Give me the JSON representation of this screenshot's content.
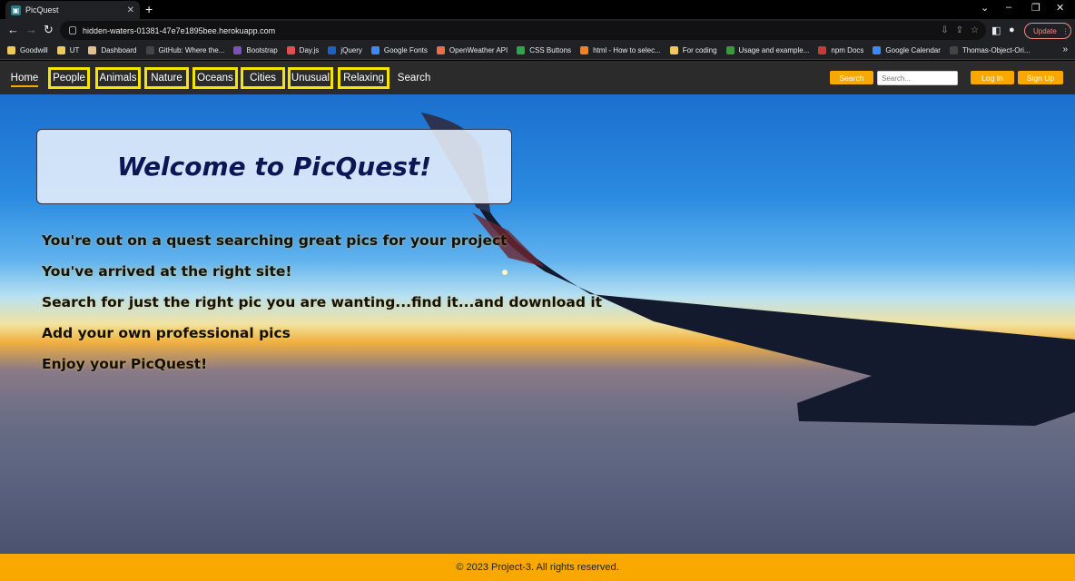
{
  "browser": {
    "tab_title": "PicQuest",
    "url": "hidden-waters-01381-47e7e1895bee.herokuapp.com",
    "update_label": "Update",
    "bookmarks": [
      {
        "label": "Goodwill",
        "color": "#f3c85a"
      },
      {
        "label": "UT",
        "color": "#f3c85a"
      },
      {
        "label": "Dashboard",
        "color": "#e0c090"
      },
      {
        "label": "GitHub: Where the...",
        "color": "#444444"
      },
      {
        "label": "Bootstrap",
        "color": "#7952b3"
      },
      {
        "label": "Day.js",
        "color": "#e05050"
      },
      {
        "label": "jQuery",
        "color": "#2060c0"
      },
      {
        "label": "Google Fonts",
        "color": "#4285f4"
      },
      {
        "label": "OpenWeather API",
        "color": "#e96e50"
      },
      {
        "label": "CSS Buttons",
        "color": "#2ea44f"
      },
      {
        "label": "html - How to selec...",
        "color": "#f48024"
      },
      {
        "label": "For coding",
        "color": "#f3c85a"
      },
      {
        "label": "Usage and example...",
        "color": "#3a9a3a"
      },
      {
        "label": "npm Docs",
        "color": "#cb3837"
      },
      {
        "label": "Google Calendar",
        "color": "#4285f4"
      },
      {
        "label": "Thomas-Object-Ori...",
        "color": "#444444"
      }
    ]
  },
  "nav": {
    "home": "Home",
    "people": "People",
    "animals": "Animals",
    "nature": "Nature",
    "oceans": "Oceans",
    "cities": "Cities",
    "unusual": "Unusual",
    "relaxing": "Relaxing",
    "search": "Search",
    "search_button": "Search",
    "search_placeholder": "Search...",
    "login": "Log In",
    "signup": "Sign Up"
  },
  "hero": {
    "title": "Welcome to PicQuest!",
    "lines": [
      "You're out on a quest searching great pics for your project",
      "You've arrived at the right site!",
      "Search for just the right pic you are wanting...find it...and download it",
      "Add your own professional pics",
      "Enjoy your PicQuest!"
    ]
  },
  "footer": {
    "text": "© 2023 Project-3. All rights reserved."
  },
  "colors": {
    "accent": "#f9a800",
    "highlight_border": "#f5e600",
    "nav_bg": "#2b2b2b",
    "title_color": "#0d1554"
  }
}
